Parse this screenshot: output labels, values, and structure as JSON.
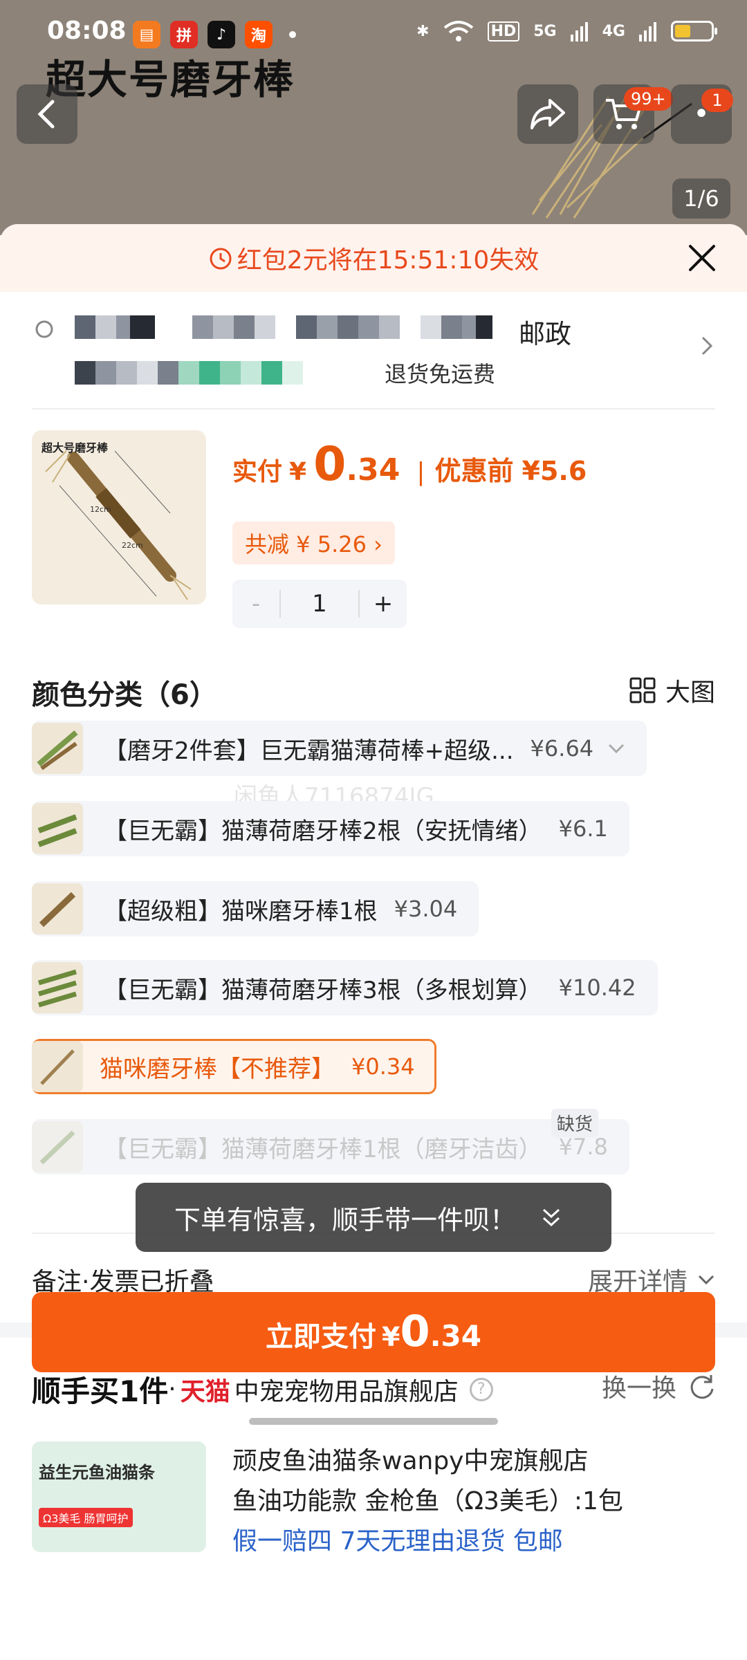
{
  "status_bar": {
    "time": "08:08",
    "apps": [
      {
        "icon": "book-app-icon",
        "color": "#f47a20"
      },
      {
        "icon": "pinduoduo-app-icon",
        "color": "#e02e24"
      },
      {
        "icon": "tiktok-app-icon",
        "color": "#111111"
      },
      {
        "icon": "taobao-app-icon",
        "color": "#ff5000"
      }
    ],
    "network": {
      "hd": "HD",
      "net1": "5G",
      "net2": "4G"
    }
  },
  "product_page": {
    "banner_title": "超大号磨牙棒",
    "cart_badge": "99+",
    "more_badge": "1",
    "image_indicator": "1/6"
  },
  "sheet": {
    "coupon_notice": "红包2元将在15:51:10失效",
    "address": {
      "line1_suffix": "邮政",
      "line2_suffix": "退货免运费"
    },
    "product": {
      "image_title": "超大号磨牙棒",
      "image_dim1": "12cm",
      "image_dim2": "22cm",
      "pay_label": "实付",
      "currency": "¥",
      "price_int": "0",
      "price_dec": ".34",
      "before_label": "优惠前",
      "before_price": "¥5.6",
      "discount": "共减 ¥ 5.26 ›",
      "quantity": "1",
      "minus": "-",
      "plus": "+"
    },
    "variants_section": {
      "title": "颜色分类（6）",
      "bigpic_label": "大图"
    },
    "variants": [
      {
        "label": "【磨牙2件套】巨无霸猫薄荷棒+超级...",
        "price": "¥6.64",
        "state": "normal",
        "expandable": true
      },
      {
        "label": "【巨无霸】猫薄荷磨牙棒2根（安抚情绪）",
        "price": "¥6.1",
        "state": "normal"
      },
      {
        "label": "【超级粗】猫咪磨牙棒1根",
        "price": "¥3.04",
        "state": "normal"
      },
      {
        "label": "【巨无霸】猫薄荷磨牙棒3根（多根划算）",
        "price": "¥10.42",
        "state": "normal"
      },
      {
        "label": "猫咪磨牙棒【不推荐】",
        "price": "¥0.34",
        "state": "selected"
      },
      {
        "label": "【巨无霸】猫薄荷磨牙棒1根（磨牙洁齿）",
        "price": "¥7.8",
        "state": "disabled",
        "tag": "缺货"
      }
    ],
    "watermark": "闲鱼人7116874JG",
    "remark": {
      "label": "备注·发票已折叠",
      "expand": "展开详情"
    },
    "addon": {
      "brand_main": "顺手买1件",
      "dot": "·",
      "tmall": "天猫",
      "store": "中宠宠物用品旗舰店",
      "help": "?",
      "swap": "换一换",
      "image_label": "益生元鱼油猫条",
      "image_tag": "Ω3美毛 肠胃呵护",
      "desc_line1": "顽皮鱼油猫条wanpy中宠旗舰店",
      "desc_line2": "鱼油功能款 金枪鱼（Ω3美毛）:1包",
      "desc_line3": "假一赔四 7天无理由退货 包邮"
    },
    "toast": "下单有惊喜，顺手带一件呗！",
    "pay_button": {
      "label": "立即支付",
      "currency": "¥",
      "int": "0",
      "dec": ".34"
    }
  },
  "colors": {
    "accent": "#f65c12",
    "price": "#e8590c",
    "coupon_bg": "#fff3ee",
    "tmall": "#e0202a"
  }
}
